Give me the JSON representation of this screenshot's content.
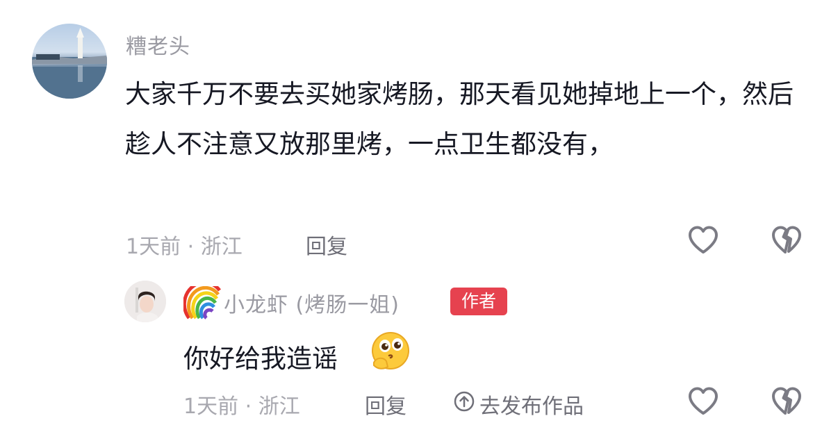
{
  "comment": {
    "username": "糟老头",
    "text": "大家千万不要去买她家烤肠，那天看见她掉地上一个，然后趁人不注意又放那里烤，一点卫生都没有，",
    "time_location": "1天前 · 浙江",
    "reply_label": "回复"
  },
  "reply": {
    "username": "小龙虾 (烤肠一姐)",
    "badge": "作者",
    "text": "你好给我造谣",
    "time_location": "1天前 · 浙江",
    "reply_label": "回复",
    "publish_label": "去发布作品"
  },
  "icons": {
    "like": "heart-outline-icon",
    "dislike": "broken-heart-icon",
    "rainbow": "rainbow-icon",
    "emoji": "pleading-face-emoji-icon",
    "publish": "arrow-up-circle-icon"
  },
  "colors": {
    "author_badge": "#e6424f",
    "username": "#9a9aa2",
    "meta": "#a8a8af"
  }
}
